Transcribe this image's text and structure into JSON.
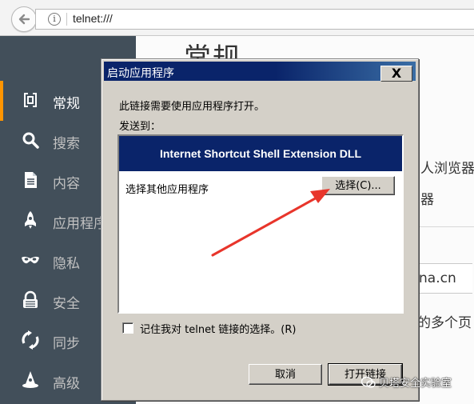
{
  "browser": {
    "url": "telnet:///"
  },
  "sidebar": {
    "items": [
      {
        "label": "常规",
        "icon": "general-icon",
        "active": true
      },
      {
        "label": "搜索",
        "icon": "search-icon"
      },
      {
        "label": "内容",
        "icon": "document-icon"
      },
      {
        "label": "应用程序",
        "icon": "rocket-icon"
      },
      {
        "label": "隐私",
        "icon": "mask-icon"
      },
      {
        "label": "安全",
        "icon": "lock-icon"
      },
      {
        "label": "同步",
        "icon": "sync-icon"
      },
      {
        "label": "高级",
        "icon": "wizard-hat-icon"
      }
    ]
  },
  "content": {
    "title": "常规",
    "fragments": [
      "人浏览器",
      "器",
      "na.cn",
      "的多个页"
    ]
  },
  "dialog": {
    "title": "启动应用程序",
    "close_label": "X",
    "message": "此链接需要使用应用程序打开。",
    "send_to_label": "发送到：",
    "apps": [
      {
        "name": "Internet Shortcut Shell Extension DLL",
        "selected": true
      }
    ],
    "other_app_label": "选择其他应用程序",
    "choose_button": "选择(C)...",
    "remember_label": "记住我对 telnet 链接的选择。(R)",
    "remember_checked": false,
    "cancel_button": "取消",
    "open_button": "打开链接"
  },
  "watermark": "贝塔安全实验室",
  "colors": {
    "sidebar_bg": "#424f5a",
    "sidebar_active": "#ff9500",
    "dialog_title_bg": "#0a246a",
    "arrow": "#e8352b"
  }
}
